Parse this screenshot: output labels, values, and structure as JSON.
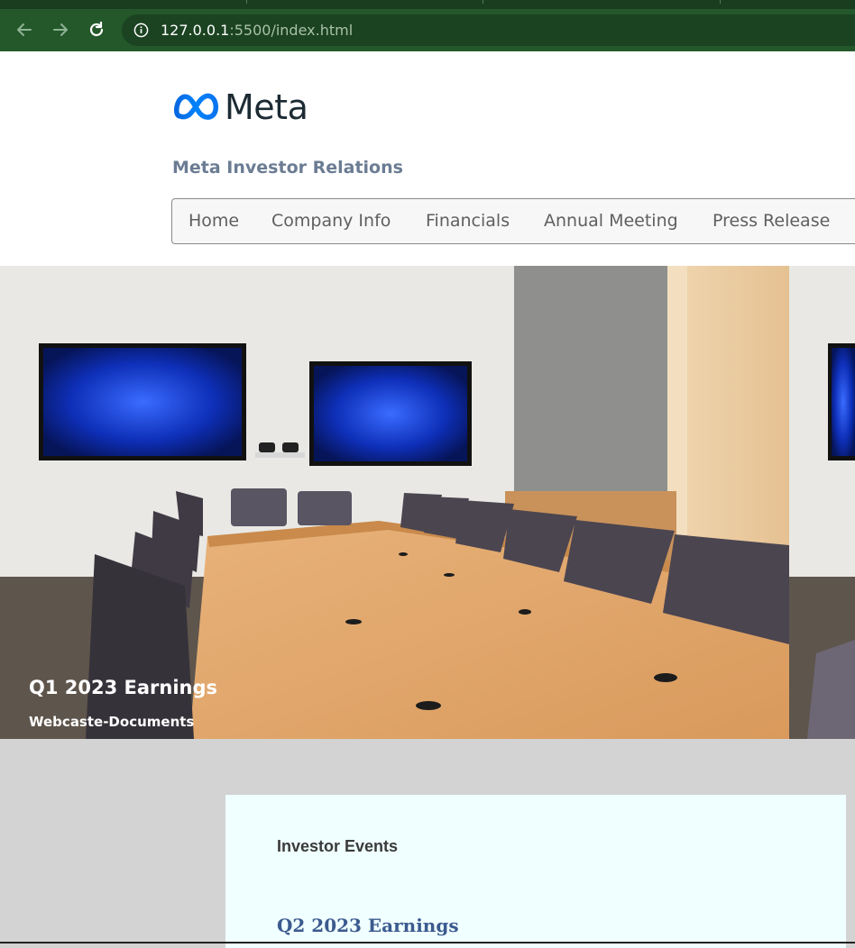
{
  "browser": {
    "url_host": "127.0.0.1",
    "url_rest": ":5500/index.html"
  },
  "header": {
    "logo_text": "Meta",
    "site_title": "Meta Investor Relations"
  },
  "nav": {
    "items": [
      "Home",
      "Company Info",
      "Financials",
      "Annual Meeting",
      "Press Release"
    ]
  },
  "hero": {
    "title": "Q1 2023 Earnings",
    "subtitle": "Webcaste-Documents"
  },
  "events": {
    "heading": "Investor Events",
    "items": [
      "Q2 2023 Earnings"
    ]
  },
  "colors": {
    "browser_toolbar": "#24582b",
    "nav_text": "#5f5f5f",
    "site_title": "#6b7c93",
    "events_bg": "#f0ffff",
    "event_link": "#3b5a8f",
    "page_bg": "#d3d3d3"
  }
}
